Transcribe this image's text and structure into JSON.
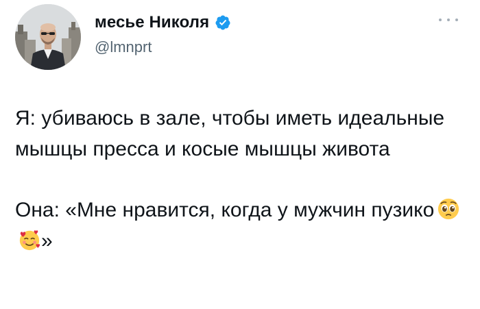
{
  "author": {
    "display_name": "месье Николя",
    "handle": "@lmnprt",
    "verified": true,
    "avatar_icon": "profile-photo"
  },
  "icons": {
    "verified": "verified-badge-icon",
    "more": "more-options-icon"
  },
  "colors": {
    "verified_blue": "#1d9bf0",
    "text": "#0f1419",
    "secondary_text": "#536471"
  },
  "tweet": {
    "paragraph_1": "Я: убиваюсь в зале, чтобы иметь идеальные мышцы пресса и косые мышцы живота",
    "paragraph_2_start": "Она: «Мне нравится, когда у мужчин пузико",
    "paragraph_2_end": "»",
    "emojis": [
      "pleading-face",
      "smiling-face-with-hearts"
    ]
  }
}
